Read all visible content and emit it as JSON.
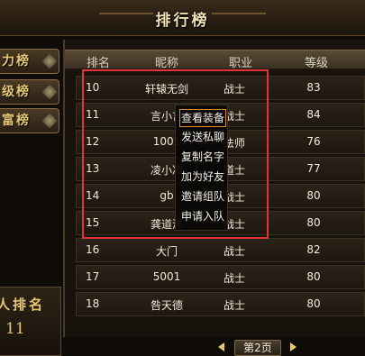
{
  "title": "排行榜",
  "side_tabs": [
    {
      "label": "力榜"
    },
    {
      "label": "级榜"
    },
    {
      "label": "富榜"
    }
  ],
  "my_rank": {
    "label": "人排名",
    "value": "11"
  },
  "table": {
    "headers": {
      "rank": "排名",
      "nickname": "昵称",
      "job": "职业",
      "level": "等级"
    },
    "rows": [
      {
        "rank": "10",
        "nickname": "轩辕无剑",
        "job": "战士",
        "level": "83"
      },
      {
        "rank": "11",
        "nickname": "言小言",
        "job": "战士",
        "level": "84"
      },
      {
        "rank": "12",
        "nickname": "1001",
        "job": "法师",
        "level": "76"
      },
      {
        "rank": "13",
        "nickname": "凌小凌",
        "job": "道士",
        "level": "77"
      },
      {
        "rank": "14",
        "nickname": "gb",
        "job": "战士",
        "level": "80"
      },
      {
        "rank": "15",
        "nickname": "龚道洋",
        "job": "战士",
        "level": "80"
      },
      {
        "rank": "16",
        "nickname": "大门",
        "job": "战士",
        "level": "82"
      },
      {
        "rank": "17",
        "nickname": "5001",
        "job": "战士",
        "level": "80"
      },
      {
        "rank": "18",
        "nickname": "咎天德",
        "job": "战士",
        "level": "80"
      }
    ]
  },
  "context_menu": {
    "items": [
      {
        "label": "查看装备"
      },
      {
        "label": "发送私聊"
      },
      {
        "label": "复制名字"
      },
      {
        "label": "加为好友"
      },
      {
        "label": "邀请组队"
      },
      {
        "label": "申请入队"
      }
    ]
  },
  "pager": {
    "label": "第2页"
  },
  "colors": {
    "accent_gold": "#e6c775",
    "highlight_red": "#e23434",
    "menu_active_border": "#d88a2a"
  }
}
